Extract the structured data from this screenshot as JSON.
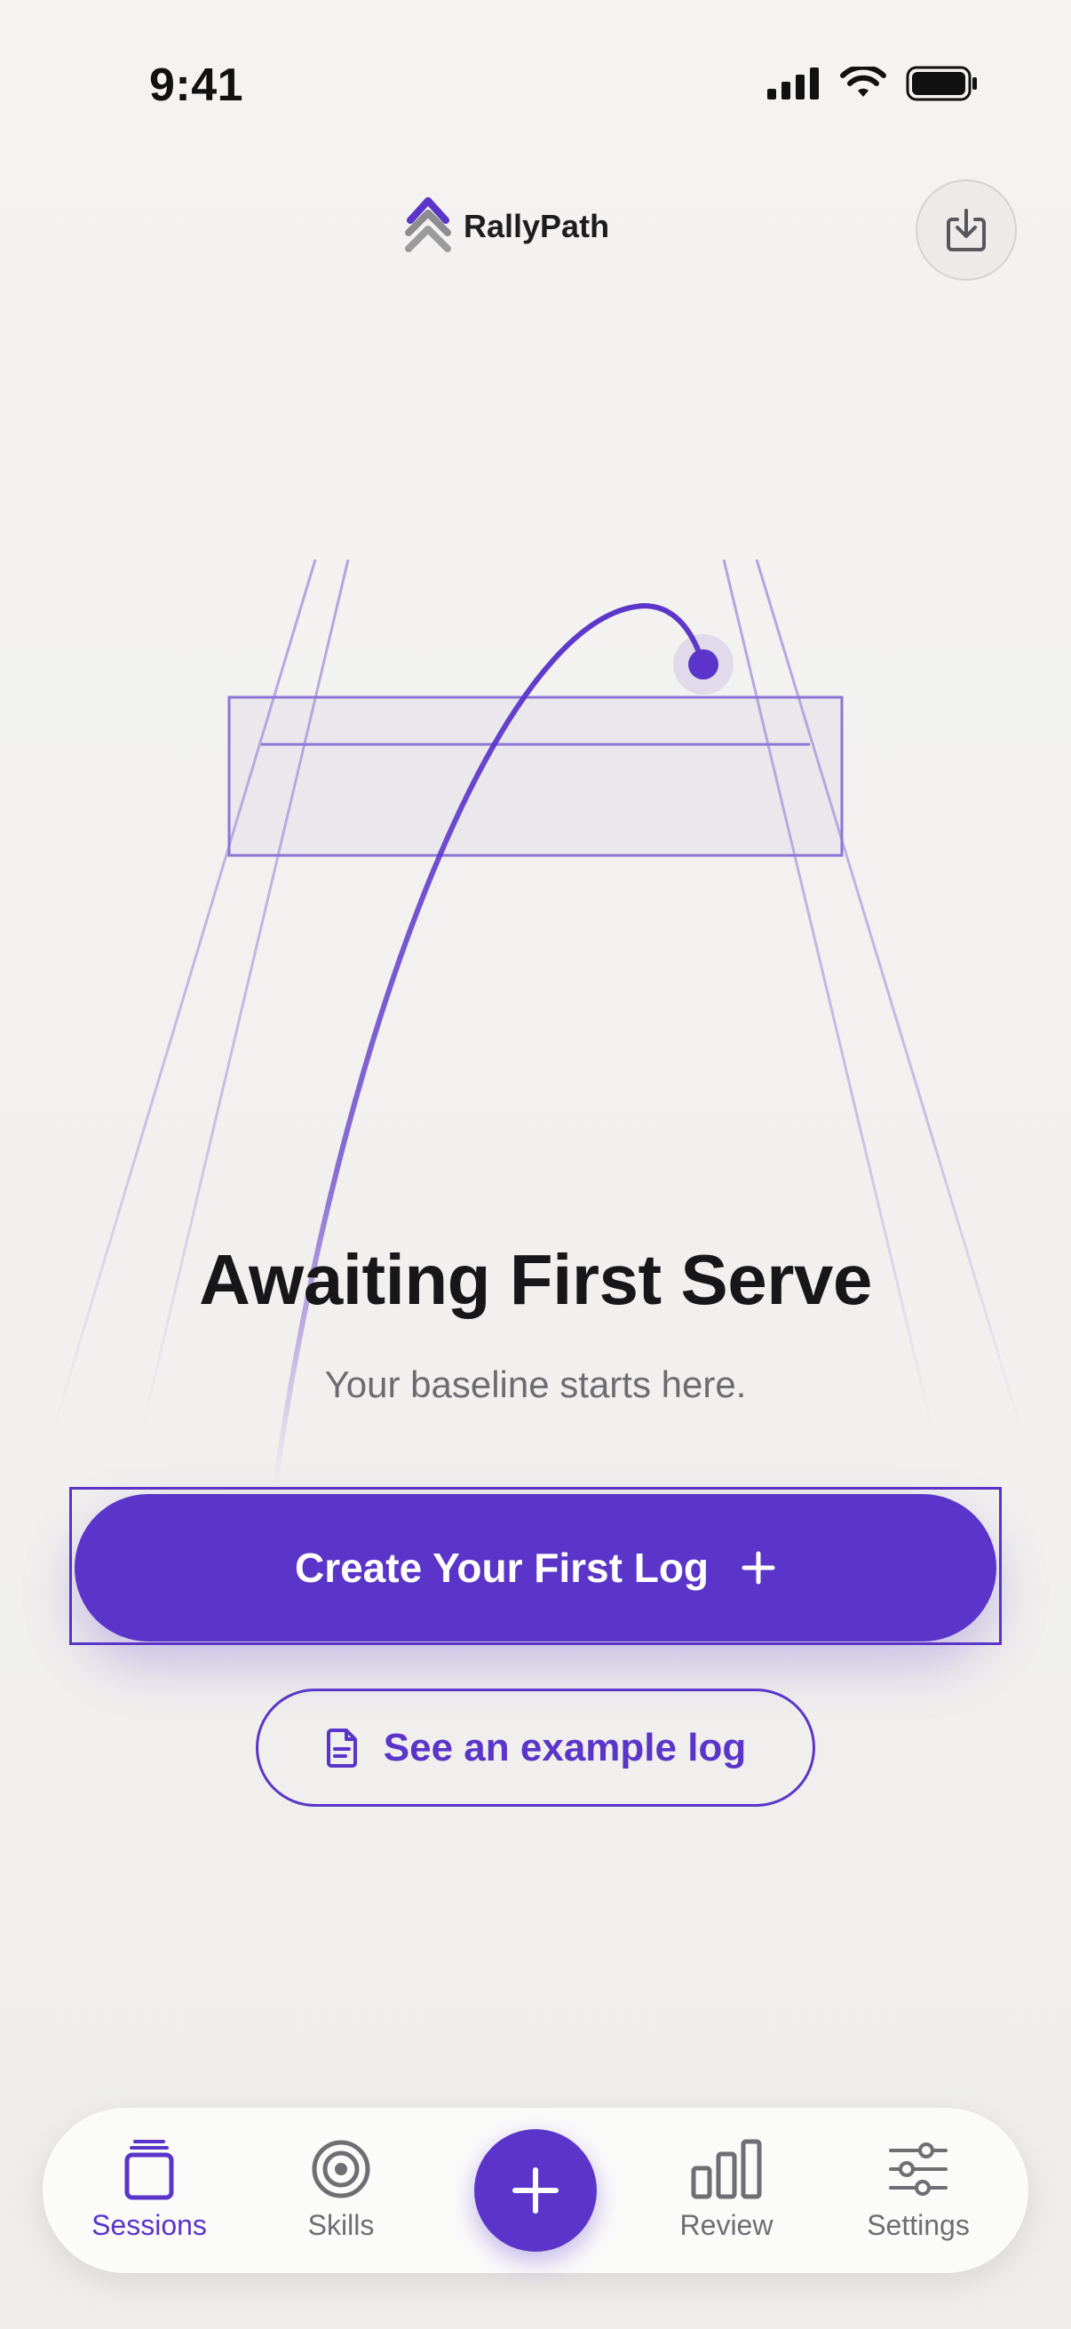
{
  "status_bar": {
    "time": "9:41"
  },
  "header": {
    "brand": "RallyPath"
  },
  "empty_state": {
    "title": "Awaiting First Serve",
    "subtitle": "Your baseline starts here."
  },
  "actions": {
    "primary": "Create Your First Log",
    "secondary": "See an example log"
  },
  "tabs": [
    {
      "label": "Sessions",
      "icon": "sessions-icon",
      "active": true
    },
    {
      "label": "Skills",
      "icon": "target-icon",
      "active": false
    },
    {
      "label": "Add",
      "icon": "plus-icon",
      "active": false
    },
    {
      "label": "Review",
      "icon": "bar-chart-icon",
      "active": false
    },
    {
      "label": "Settings",
      "icon": "sliders-icon",
      "active": false
    }
  ],
  "colors": {
    "accent": "#5b35c9",
    "background": "#f2f1ef",
    "text": "#17171a",
    "muted": "#6b6b70"
  }
}
